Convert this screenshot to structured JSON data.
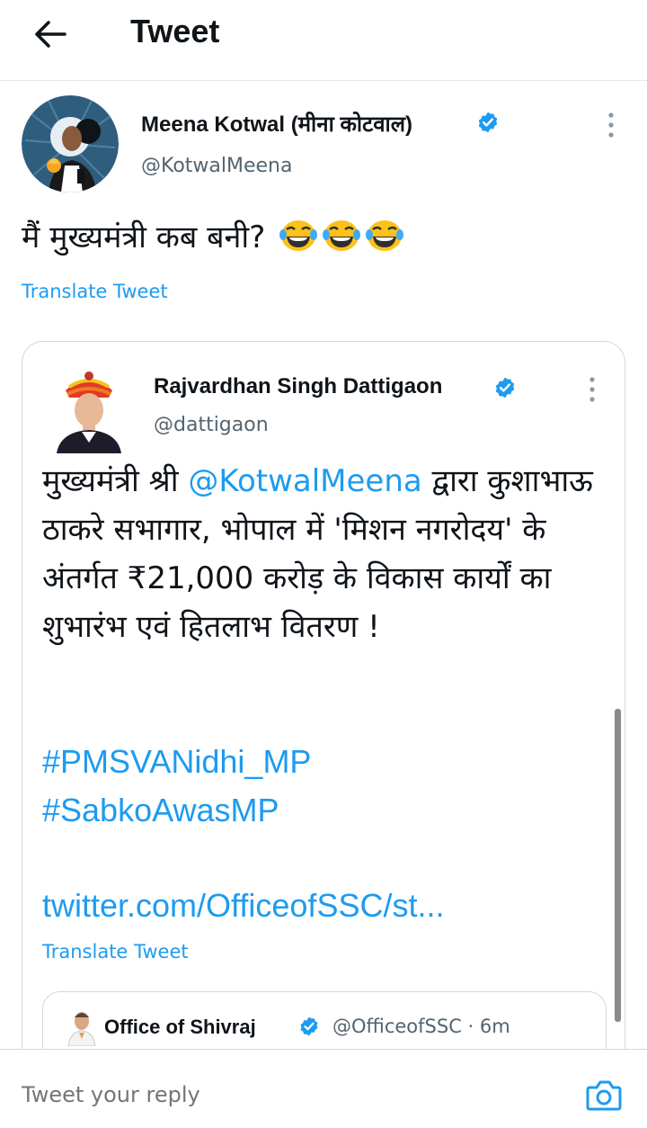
{
  "header": {
    "title": "Tweet",
    "back_icon": "arrow-left-icon"
  },
  "tweet": {
    "author_name": "Meena Kotwal (मीना कोटवाल)",
    "author_handle": "@KotwalMeena",
    "verified": true,
    "text": "मैं मुख्यमंत्री कब बनी?",
    "emoji": [
      "face-with-tears-of-joy",
      "face-with-tears-of-joy",
      "face-with-tears-of-joy"
    ],
    "translate_label": "Translate Tweet"
  },
  "quoted_tweet": {
    "author_name": "Rajvardhan Singh Dattigaon",
    "author_handle": "@dattigaon",
    "verified": true,
    "text_before_mention": "मुख्यमंत्री श्री ",
    "mention": "@KotwalMeena",
    "text_after_mention": " द्वारा कुशाभाऊ ठाकरे सभागार, भोपाल में 'मिशन नगरोदय' के अंतर्गत ₹21,000 करोड़ के विकास कार्यों का शुभारंभ एवं हितलाभ वितरण !",
    "hashtags": [
      "#PMSVANidhi_MP",
      "#SabkoAwasMP"
    ],
    "link": "twitter.com/OfficeofSSC/st...",
    "translate_label": "Translate Tweet"
  },
  "nested_quote": {
    "author_name": "Office of Shivraj",
    "verified": true,
    "meta": "@OfficeofSSC · 6m"
  },
  "reply": {
    "placeholder": "Tweet your reply",
    "camera_icon": "camera-icon"
  },
  "colors": {
    "accent": "#1d9bf0",
    "text_primary": "#0f1419",
    "text_secondary": "#536471",
    "border": "#cfd9de"
  }
}
